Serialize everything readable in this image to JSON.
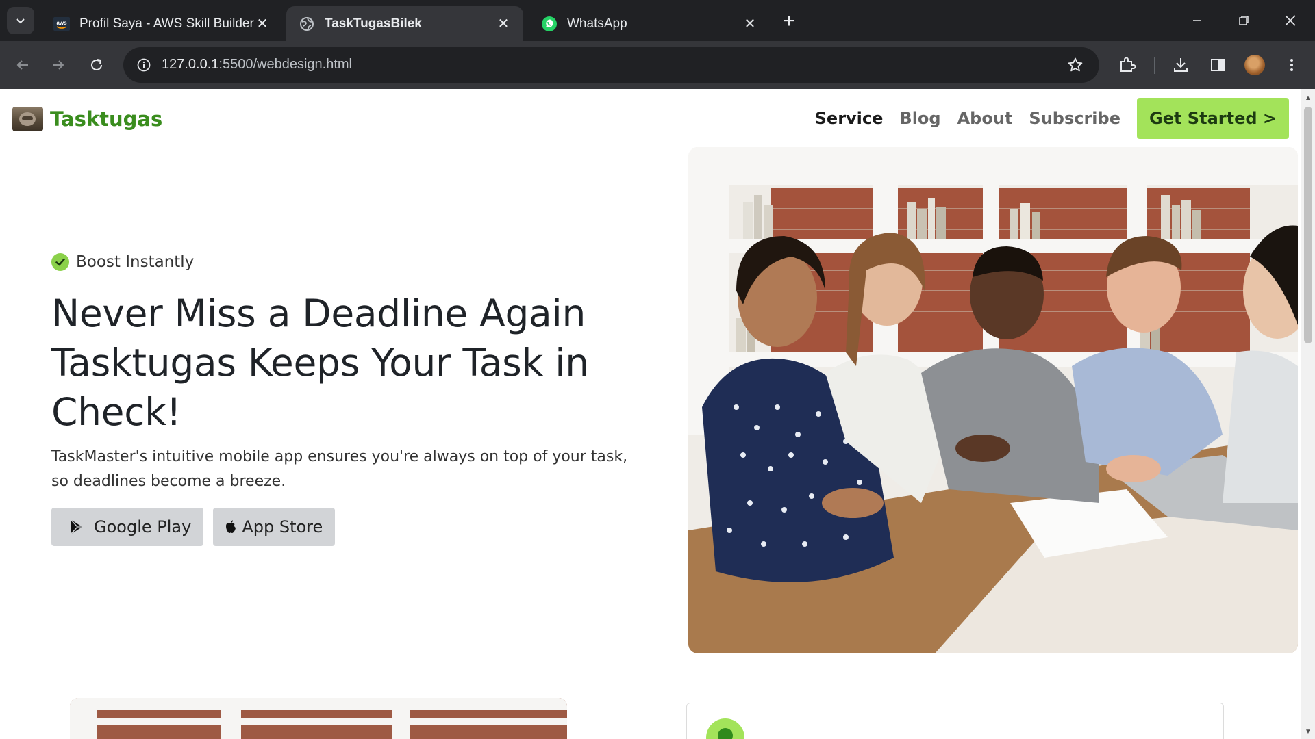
{
  "browser": {
    "tabs": [
      {
        "title": "Profil Saya - AWS Skill Builder",
        "icon": "aws-icon",
        "active": false
      },
      {
        "title": "TaskTugasBilek",
        "icon": "globe-icon",
        "active": true
      },
      {
        "title": "WhatsApp",
        "icon": "whatsapp-icon",
        "active": false
      }
    ],
    "url_host": "127.0.0.1",
    "url_path": ":5500/webdesign.html"
  },
  "site": {
    "brand": "Tasktugas",
    "nav": [
      "Service",
      "Blog",
      "About",
      "Subscribe"
    ],
    "cta": "Get Started >",
    "colors": {
      "accent": "#a3e35a",
      "brand": "#3a8d1e"
    }
  },
  "hero": {
    "badge": "Boost Instantly",
    "headline": "Never Miss a Deadline Again Tasktugas Keeps Your Task in Check!",
    "description": "TaskMaster's intuitive mobile app ensures you're always on top of your task, so deadlines become a breeze.",
    "google_play": "Google Play",
    "app_store": "App Store"
  }
}
